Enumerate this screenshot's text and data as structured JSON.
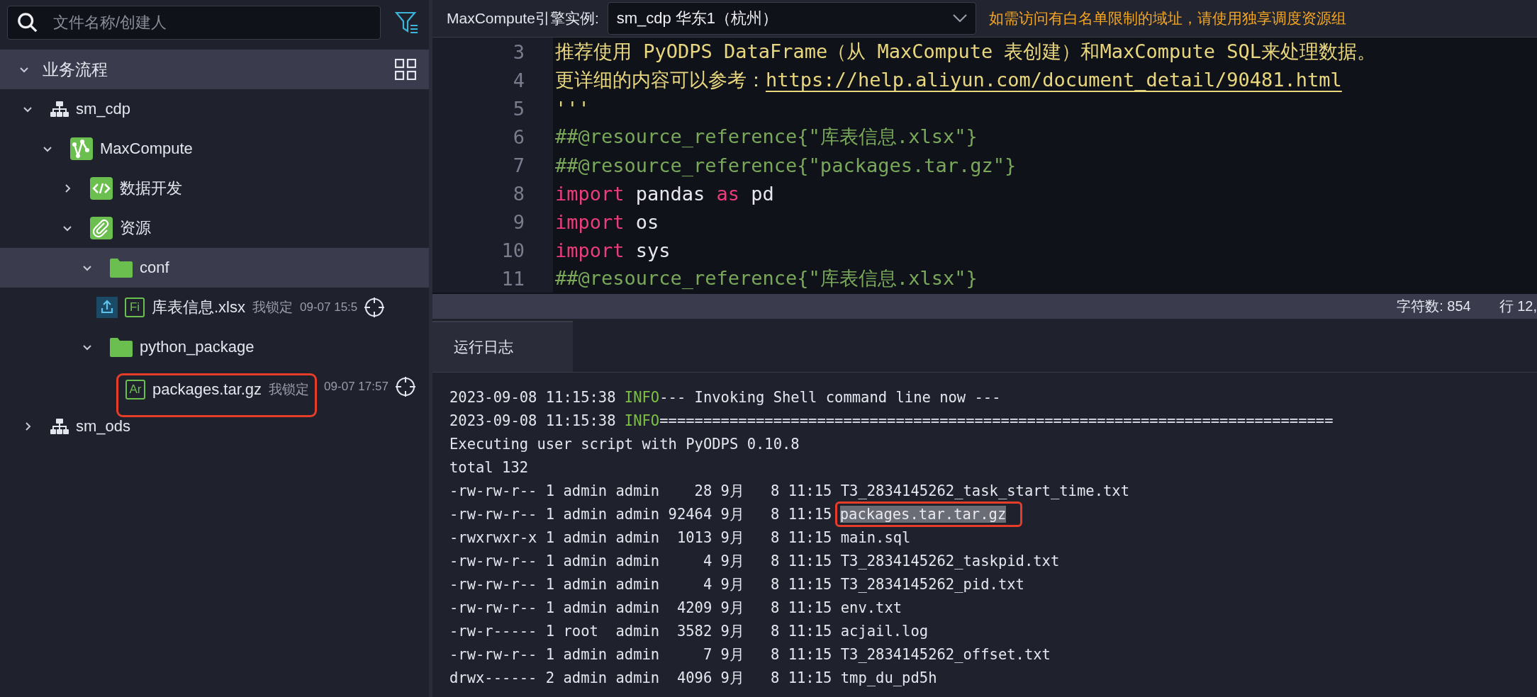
{
  "sidebar": {
    "search": {
      "placeholder": "文件名称/创建人"
    },
    "section": {
      "title": "业务流程",
      "expanded": true
    },
    "tree": [
      {
        "kind": "workflow",
        "label": "sm_cdp",
        "expanded": true,
        "selected": false,
        "children": [
          {
            "kind": "maxcompute",
            "label": "MaxCompute",
            "expanded": true,
            "selected": false,
            "children": [
              {
                "kind": "code",
                "label": "数据开发",
                "expanded": false,
                "selected": false
              },
              {
                "kind": "resource",
                "label": "资源",
                "expanded": true,
                "selected": false,
                "children": [
                  {
                    "kind": "folder",
                    "label": "conf",
                    "expanded": true,
                    "selected": true,
                    "children": [
                      {
                        "kind": "file",
                        "badge": "Fi",
                        "label": "库表信息.xlsx",
                        "uploaded": true,
                        "lock": "我锁定",
                        "time": "09-07 15:5",
                        "selected": false,
                        "annotated": false
                      }
                    ]
                  },
                  {
                    "kind": "folder",
                    "label": "python_package",
                    "expanded": true,
                    "selected": false,
                    "children": [
                      {
                        "kind": "file",
                        "badge": "Ar",
                        "label": "packages.tar.gz",
                        "uploaded": false,
                        "lock": "我锁定",
                        "time": "09-07 17:57",
                        "selected": false,
                        "annotated": true
                      }
                    ]
                  }
                ]
              }
            ]
          }
        ]
      },
      {
        "kind": "workflow",
        "label": "sm_ods",
        "expanded": false,
        "selected": false
      }
    ]
  },
  "toolbar": {
    "engine_label": "MaxCompute引擎实例:",
    "engine_value": "sm_cdp 华东1（杭州）",
    "notice": "如需访问有白名单限制的域址，请使用独享调度资源组"
  },
  "editor": {
    "lines": [
      {
        "number": "3",
        "tokens": [
          {
            "kind": "string",
            "text": "推荐使用 PyODPS DataFrame（从 MaxCompute 表创建）和MaxCompute SQL来处理数据。"
          }
        ]
      },
      {
        "number": "4",
        "tokens": [
          {
            "kind": "string",
            "text": "更详细的内容可以参考："
          },
          {
            "kind": "link",
            "text": "https://help.aliyun.com/document_detail/90481.html"
          }
        ]
      },
      {
        "number": "5",
        "tokens": [
          {
            "kind": "string",
            "text": "'''"
          }
        ]
      },
      {
        "number": "6",
        "tokens": [
          {
            "kind": "comment",
            "text": "##@resource_reference{\"库表信息.xlsx\"}"
          }
        ]
      },
      {
        "number": "7",
        "tokens": [
          {
            "kind": "comment",
            "text": "##@resource_reference{\"packages.tar.gz\"}"
          }
        ]
      },
      {
        "number": "8",
        "tokens": [
          {
            "kind": "keyword",
            "text": "import"
          },
          {
            "kind": "name",
            "text": " pandas "
          },
          {
            "kind": "keyword",
            "text": "as"
          },
          {
            "kind": "name",
            "text": " pd"
          }
        ]
      },
      {
        "number": "9",
        "tokens": [
          {
            "kind": "keyword",
            "text": "import"
          },
          {
            "kind": "name",
            "text": " os"
          }
        ]
      },
      {
        "number": "10",
        "tokens": [
          {
            "kind": "keyword",
            "text": "import"
          },
          {
            "kind": "name",
            "text": " sys"
          }
        ]
      },
      {
        "number": "11",
        "tokens": [
          {
            "kind": "comment",
            "text": "##@resource_reference{\"库表信息.xlsx\"}"
          }
        ]
      }
    ]
  },
  "status_bar": {
    "char_count": "字符数: 854",
    "position": "行 12,"
  },
  "log_panel": {
    "tabs": [
      {
        "label": "运行日志",
        "selected": true
      }
    ],
    "lines": [
      {
        "kind": "info",
        "time": "2023-09-08 11:15:38",
        "level": "INFO",
        "message": "--- Invoking Shell command line now ---"
      },
      {
        "kind": "info",
        "time": "2023-09-08 11:15:38",
        "level": "INFO",
        "message": "============================================================================="
      },
      {
        "kind": "plain",
        "text": "Executing user script with PyODPS 0.10.8"
      },
      {
        "kind": "plain",
        "text": "total 132"
      },
      {
        "kind": "file",
        "meta": "-rw-rw-r-- 1 admin admin    28 9月   8 11:15",
        "name": "T3_2834145262_task_start_time.txt",
        "selected": false,
        "annotated": false
      },
      {
        "kind": "file",
        "meta": "-rw-rw-r-- 1 admin admin 92464 9月   8 11:15",
        "name": "packages.tar.tar.gz",
        "selected": true,
        "annotated": true
      },
      {
        "kind": "file",
        "meta": "-rwxrwxr-x 1 admin admin  1013 9月   8 11:15",
        "name": "main.sql",
        "selected": false,
        "annotated": false
      },
      {
        "kind": "file",
        "meta": "-rw-rw-r-- 1 admin admin     4 9月   8 11:15",
        "name": "T3_2834145262_taskpid.txt",
        "selected": false,
        "annotated": false
      },
      {
        "kind": "file",
        "meta": "-rw-rw-r-- 1 admin admin     4 9月   8 11:15",
        "name": "T3_2834145262_pid.txt",
        "selected": false,
        "annotated": false
      },
      {
        "kind": "file",
        "meta": "-rw-rw-r-- 1 admin admin  4209 9月   8 11:15",
        "name": "env.txt",
        "selected": false,
        "annotated": false
      },
      {
        "kind": "file",
        "meta": "-rw-r----- 1 root  admin  3582 9月   8 11:15",
        "name": "acjail.log",
        "selected": false,
        "annotated": false
      },
      {
        "kind": "file",
        "meta": "-rw-rw-r-- 1 admin admin     7 9月   8 11:15",
        "name": "T3_2834145262_offset.txt",
        "selected": false,
        "annotated": false
      },
      {
        "kind": "file",
        "meta": "drwx------ 2 admin admin  4096 9月   8 11:15",
        "name": "tmp_du_pd5h",
        "selected": false,
        "annotated": false
      }
    ]
  }
}
